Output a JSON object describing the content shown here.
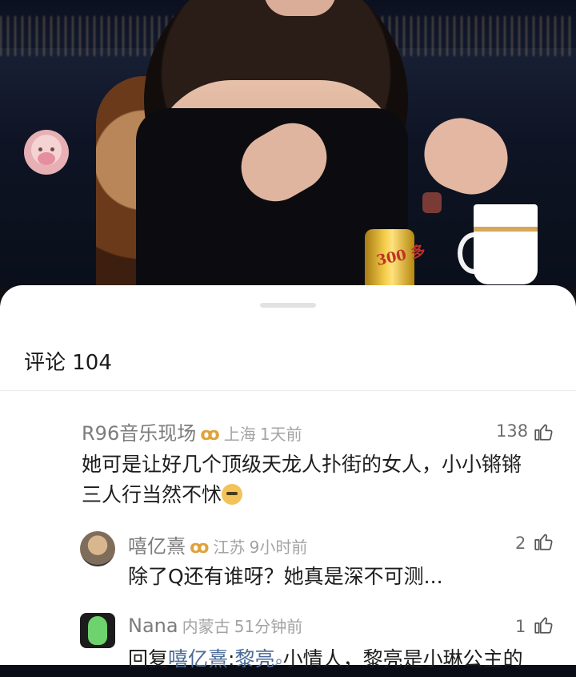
{
  "comments_title": "评论 104",
  "comments": [
    {
      "user": "R96音乐现场",
      "vip": "ꝏ",
      "location": "上海",
      "time": "1天前",
      "likes": "138",
      "line1": "她可是让好几个顶级天龙人扑街的女人，小小锵锵",
      "line2": "三人行当然不怵"
    },
    {
      "user": "嘻亿熹",
      "vip": "ꝏ",
      "location": "江苏",
      "time": "9小时前",
      "likes": "2",
      "line1": "除了Q还有谁呀？她真是深不可测..."
    },
    {
      "user": "Nana",
      "location": "内蒙古",
      "time": "51分钟前",
      "likes": "1",
      "reply_prefix": "回复",
      "reply_to": "嘻亿熹",
      "reply_sep": ":",
      "mention": "黎亮",
      "rest": "小情人，黎亮是小琳公主的"
    }
  ],
  "video_can_text": "300 多"
}
